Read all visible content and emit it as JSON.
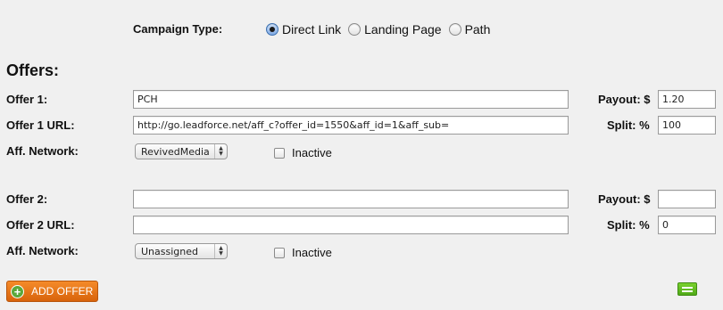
{
  "campaign": {
    "label": "Campaign Type:",
    "options": [
      "Direct Link",
      "Landing Page",
      "Path"
    ],
    "selected": "Direct Link"
  },
  "offers_heading": "Offers:",
  "offers": [
    {
      "name_label": "Offer 1:",
      "name_value": "PCH",
      "url_label": "Offer 1 URL:",
      "url_value": "http://go.leadforce.net/aff_c?offer_id=1550&aff_id=1&aff_sub=",
      "network_label": "Aff. Network:",
      "network_value": "RevivedMedia",
      "inactive_label": "Inactive",
      "inactive_checked": false,
      "payout_label": "Payout: $",
      "payout_value": "1.20",
      "split_label": "Split: %",
      "split_value": "100"
    },
    {
      "name_label": "Offer 2:",
      "name_value": "",
      "url_label": "Offer 2 URL:",
      "url_value": "",
      "network_label": "Aff. Network:",
      "network_value": "Unassigned",
      "inactive_label": "Inactive",
      "inactive_checked": false,
      "payout_label": "Payout: $",
      "payout_value": "",
      "split_label": "Split: %",
      "split_value": "0"
    }
  ],
  "add_offer_label": "ADD OFFER",
  "icons": {
    "add": "plus-circle-icon",
    "menu": "equals-icon",
    "select_arrows": "updown-arrows-icon"
  },
  "colors": {
    "add_button": "#e8761a",
    "green_button": "#5fbf20"
  }
}
